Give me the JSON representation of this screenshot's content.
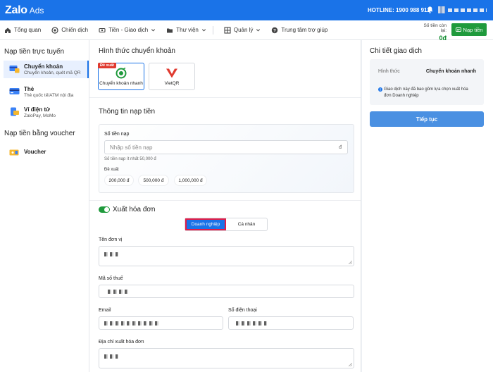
{
  "topbar": {
    "logo_main": "Zalo",
    "logo_sub": "Ads",
    "hotline": "HOTLINE: 1900 988 912"
  },
  "nav": {
    "items": [
      {
        "label": "Tổng quan",
        "icon": "home-icon"
      },
      {
        "label": "Chiến dịch",
        "icon": "target-icon"
      },
      {
        "label": "Tiền - Giao dịch",
        "icon": "money-icon",
        "dropdown": true
      },
      {
        "label": "Thư viện",
        "icon": "folder-icon",
        "dropdown": true
      },
      {
        "label": "Quản lý",
        "icon": "grid-icon",
        "dropdown": true
      },
      {
        "label": "Trung tâm trợ giúp",
        "icon": "help-icon"
      }
    ],
    "balance_label": "Số tiền còn lại:",
    "balance_value": "0đ",
    "topup_button": "Nạp tiền"
  },
  "sidebar": {
    "section1": "Nạp tiền trực tuyến",
    "items": [
      {
        "title": "Chuyển khoản",
        "subtitle": "Chuyển khoản, quét mã QR",
        "active": true
      },
      {
        "title": "Thẻ",
        "subtitle": "Thẻ quốc tế/ATM nội địa",
        "active": false
      },
      {
        "title": "Ví điện tử",
        "subtitle": "ZaloPay, MoMo",
        "active": false
      }
    ],
    "section2": "Nạp tiền bằng voucher",
    "voucher": "Voucher"
  },
  "main": {
    "method_title": "Hình thức chuyển khoản",
    "methods": [
      {
        "label": "Chuyển khoản nhanh",
        "badge": "Đề xuất",
        "selected": true
      },
      {
        "label": "VietQR",
        "badge": "",
        "selected": false
      }
    ],
    "topup_info_title": "Thông tin nạp tiền",
    "amount_label": "Số tiền nạp",
    "amount_placeholder": "Nhập số tiền nạp",
    "amount_unit": "đ",
    "amount_hint": "Số tiền nạp ít nhất 50,000 đ",
    "suggest_label": "Đề xuất",
    "suggestions": [
      "200,000 đ",
      "500,000 đ",
      "1,000,000 đ"
    ],
    "invoice_label": "Xuất hóa đơn",
    "invoice_enabled": true,
    "invoice_types": [
      "Doanh nghiệp",
      "Cá nhân"
    ],
    "invoice_selected": "Doanh nghiệp",
    "fields": {
      "company_name": "Tên đơn vị",
      "tax_code": "Mã số thuế",
      "email": "Email",
      "phone": "Số điện thoại",
      "address": "Địa chỉ xuất hóa đơn"
    }
  },
  "right": {
    "title": "Chi tiết giao dịch",
    "method_label": "Hình thức",
    "method_value": "Chuyển khoản nhanh",
    "note": "Giao dịch này đã bao gồm lựa chọn xuất hóa đơn Doanh nghiệp",
    "continue_button": "Tiếp tục"
  },
  "colors": {
    "primary": "#1a73e8",
    "success": "#1f9a3c",
    "badge": "#e03a2f",
    "highlight": "#e11d48"
  }
}
